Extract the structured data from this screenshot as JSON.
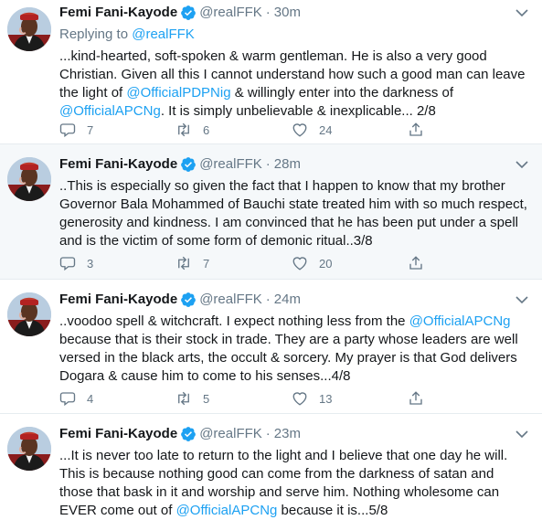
{
  "colors": {
    "link": "#1da1f2",
    "secondary_text": "#657786",
    "highlight_bg": "#f5f8fa",
    "divider": "#e6ecf0"
  },
  "icons": {
    "verified": "verified-badge-icon",
    "reply": "reply-icon",
    "retweet": "retweet-icon",
    "like": "heart-icon",
    "share": "share-icon",
    "more": "chevron-down-icon"
  },
  "tweets": [
    {
      "name": "Femi Fani-Kayode",
      "handle": "@realFFK",
      "time": "30m",
      "replying_prefix": "Replying to ",
      "replying_to": "@realFFK",
      "lines": [
        {
          "text": "...kind-hearted, soft-spoken & warm gentleman. He is also a very good"
        },
        {
          "text": "Christian. Given all this I cannot understand how such a good man can leave"
        },
        {
          "text_a": "the light of ",
          "link_a": "@OfficialPDPNig",
          "text_b": " & willingly enter into the darkness of"
        },
        {
          "link_a": "@OfficialAPCNg",
          "text_b": ". It is simply unbelievable & inexplicable... 2/8"
        }
      ],
      "replies": "7",
      "retweets": "6",
      "likes": "24"
    },
    {
      "name": "Femi Fani-Kayode",
      "handle": "@realFFK",
      "time": "28m",
      "lines": [
        {
          "text": "..This is especially so given the fact that I happen to know that my brother"
        },
        {
          "text": "Governor Bala Mohammed of Bauchi state treated him with so much respect,"
        },
        {
          "text": "generosity and kindness. I am convinced that he  has been put under a spell"
        },
        {
          "text": "and is the victim of some form of demonic ritual..3/8"
        }
      ],
      "replies": "3",
      "retweets": "7",
      "likes": "20"
    },
    {
      "name": "Femi Fani-Kayode",
      "handle": "@realFFK",
      "time": "24m",
      "lines": [
        {
          "text_a": "..voodoo spell & witchcraft. I expect nothing less from the ",
          "link_a": "@OfficialAPCNg"
        },
        {
          "text": "because that is their stock in trade. They are a party whose leaders are well"
        },
        {
          "text": "versed in the black arts, the occult & sorcery. My prayer is that God delivers"
        },
        {
          "text": "Dogara & cause him to come to his senses...4/8"
        }
      ],
      "replies": "4",
      "retweets": "5",
      "likes": "13"
    },
    {
      "name": "Femi Fani-Kayode",
      "handle": "@realFFK",
      "time": "23m",
      "lines": [
        {
          "text": "...It is never too late to return to the light and I believe that one day he will."
        },
        {
          "text": "This is because nothing good can come from the darkness of satan and"
        },
        {
          "text": "those that  bask in it and worship and serve him. Nothing wholesome can"
        },
        {
          "text_a": "EVER come out of ",
          "link_a": "@OfficialAPCNg",
          "text_b": " because it is...5/8"
        }
      ]
    }
  ]
}
